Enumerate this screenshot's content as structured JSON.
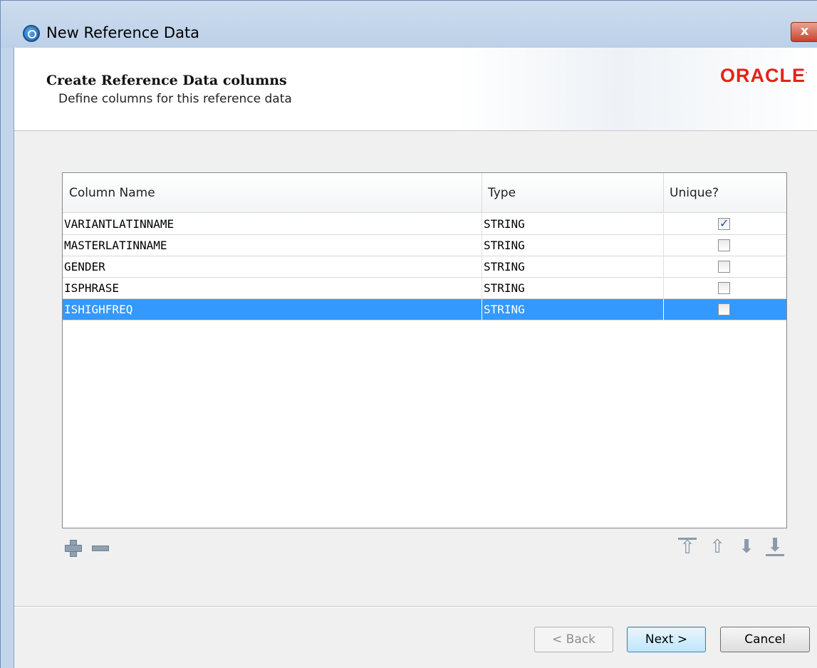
{
  "window": {
    "title": "New Reference Data",
    "close_label": "x"
  },
  "header": {
    "title": "Create Reference Data columns",
    "subtitle": "Define columns for this reference data",
    "logo": "ORACLE"
  },
  "table": {
    "columns": [
      "Column Name",
      "Type",
      "Unique?"
    ],
    "rows": [
      {
        "name": "VARIANTLATINNAME",
        "type": "STRING",
        "unique": true,
        "selected": false
      },
      {
        "name": "MASTERLATINNAME",
        "type": "STRING",
        "unique": false,
        "selected": false
      },
      {
        "name": "GENDER",
        "type": "STRING",
        "unique": false,
        "selected": false
      },
      {
        "name": "ISPHRASE",
        "type": "STRING",
        "unique": false,
        "selected": false
      },
      {
        "name": "ISHIGHFREQ",
        "type": "STRING",
        "unique": false,
        "selected": true
      }
    ]
  },
  "toolbar": {
    "icons": [
      "plus-icon",
      "minus-icon",
      "move-top-icon",
      "move-up-icon",
      "move-down-icon",
      "move-bottom-icon"
    ]
  },
  "buttons": {
    "back": "< Back",
    "next": "Next >",
    "cancel": "Cancel"
  },
  "colors": {
    "selection": "#3399ff",
    "oracle_red": "#e2241a"
  }
}
